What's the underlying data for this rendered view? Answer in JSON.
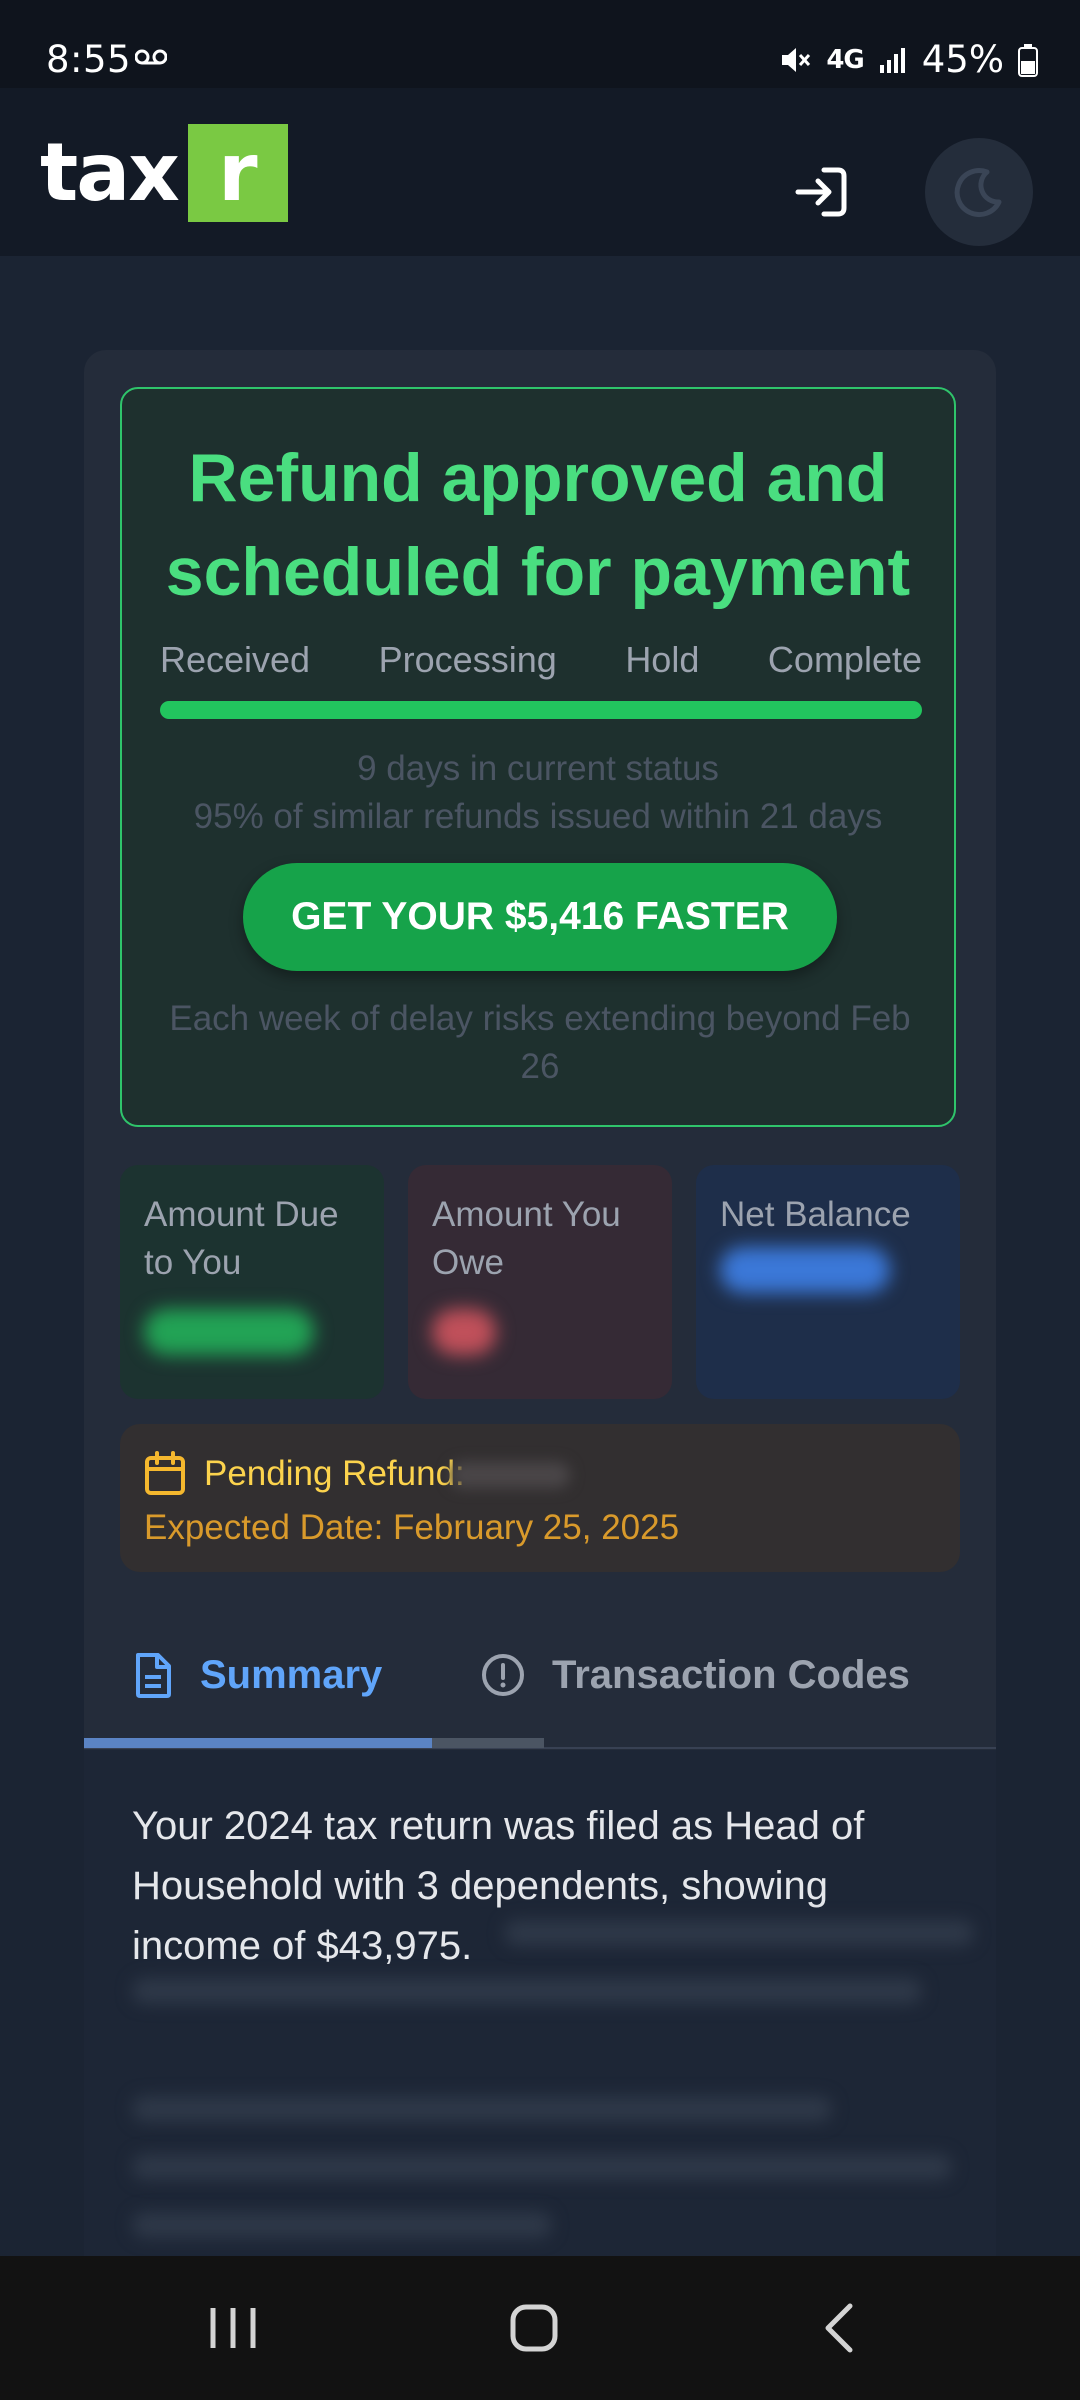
{
  "status_bar": {
    "time": "8:55",
    "network": "4G",
    "battery": "45%"
  },
  "header": {
    "logo_text": "tax",
    "logo_box_letter": "r",
    "logo_colors": {
      "text": "#ffffff",
      "box": "#7ac943"
    },
    "icons": [
      "login-icon",
      "moon-icon"
    ]
  },
  "refund_status": {
    "title": "Refund approved and scheduled for payment",
    "steps": [
      "Received",
      "Processing",
      "Hold",
      "Complete"
    ],
    "progress_fraction": 1.0,
    "days_in_status": "9 days in current status",
    "similar_refunds": "95% of similar refunds issued within 21 days",
    "cta_label": "GET YOUR $5,416 FASTER",
    "delay_note": "Each week of delay risks extending beyond Feb 26",
    "colors": {
      "accent": "#4ade80",
      "border": "#2fc46b",
      "button": "#16a34a"
    }
  },
  "summary_tiles": [
    {
      "label": "Amount Due to You",
      "color": "#22a355"
    },
    {
      "label": "Amount You Owe",
      "color": "#c0505a"
    },
    {
      "label": "Net Balance",
      "color": "#3b78d8"
    }
  ],
  "pending": {
    "title": "Pending Refund:",
    "expected": "Expected Date: February 25, 2025",
    "icon": "calendar-icon"
  },
  "tabs": [
    {
      "label": "Summary",
      "icon": "document-icon",
      "active": true
    },
    {
      "label": "Transaction Codes",
      "icon": "alert-circle-icon",
      "active": false
    }
  ],
  "summary": {
    "text": "Your 2024 tax return was filed as Head of Household with 3 dependents, showing income of $43,975."
  },
  "nav": {
    "icons": [
      "recents-icon",
      "home-icon",
      "back-icon"
    ]
  }
}
